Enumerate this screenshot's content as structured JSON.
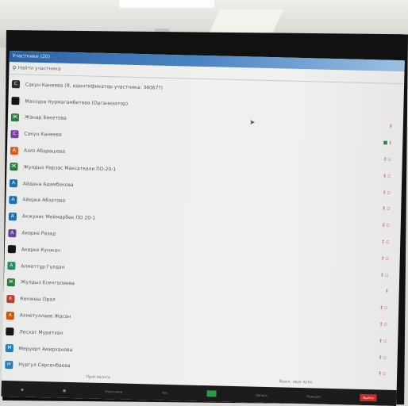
{
  "window": {
    "title": "Участники (20)"
  },
  "search": {
    "placeholder": "Найти участника"
  },
  "participants": [
    {
      "name": "Сакун Канеева (Я, идентификатор участника: 34067?)",
      "initial": "С",
      "color": "#2b2b2b",
      "status": ""
    },
    {
      "name": "Манзура Нурмагамбетова (Организатор)",
      "initial": "",
      "color": "#151515",
      "status": ""
    },
    {
      "name": "Жанар Бекетова",
      "initial": "Ж",
      "color": "#2b7a3b",
      "status": "mic"
    },
    {
      "name": "Сакун Канеева",
      "initial": "С",
      "color": "#7a3ea1",
      "status": "share-mic"
    },
    {
      "name": "Азиз Абдрашева",
      "initial": "А",
      "color": "#e05a1e",
      "status": "mic-video"
    },
    {
      "name": "Жулдыз Нарзас Максатқали ПО-20-1",
      "initial": "Ж",
      "color": "#2b7a3b",
      "status": "mic-video"
    },
    {
      "name": "Айдана Адамбекова",
      "initial": "А",
      "color": "#1f6fb3",
      "status": "mic-video"
    },
    {
      "name": "Айерке Абзатова",
      "initial": "А",
      "color": "#1f6fb3",
      "status": "mic-video"
    },
    {
      "name": "Акжунис Меймарбек ПО 20-1",
      "initial": "А",
      "color": "#1f6fb3",
      "status": "mic-video"
    },
    {
      "name": "Акерке Разад",
      "initial": "А",
      "color": "#6a3da1",
      "status": "mic-video"
    },
    {
      "name": "Акерке Күнжан",
      "initial": "",
      "color": "#151515",
      "status": "mic-video"
    },
    {
      "name": "Алматтұр Гүлдан",
      "initial": "А",
      "color": "#2a8a5a",
      "status": "mic-video"
    },
    {
      "name": "Жулдыз Есенгалиева",
      "initial": "Ж",
      "color": "#2b7a3b",
      "status": "mic"
    },
    {
      "name": "Кенжеш Орал",
      "initial": "К",
      "color": "#c0392b",
      "status": "mic-video"
    },
    {
      "name": "Ахметуллаев Жасан",
      "initial": "А",
      "color": "#d35400",
      "status": "mic-video"
    },
    {
      "name": "Лесхат Муратхан",
      "initial": "",
      "color": "#151515",
      "status": "mic-video"
    },
    {
      "name": "Меруерт Амирханова",
      "initial": "М",
      "color": "#1f7fc0",
      "status": "mic-video"
    },
    {
      "name": "Нургул Сәрсенбаева",
      "initial": "Н",
      "color": "#1f7fc0",
      "status": "mic-video"
    }
  ],
  "footer": {
    "invite": "Пригласить",
    "mute_all": "Выкл. звук всех"
  },
  "taskbar": {
    "mic_label": "",
    "video_label": "",
    "participants_label": "Участники",
    "chat_label": "Чат",
    "share_label": "Демонстрация экрана",
    "record_label": "Запись",
    "reactions_label": "Реакции",
    "leave_label": "Выйти"
  }
}
